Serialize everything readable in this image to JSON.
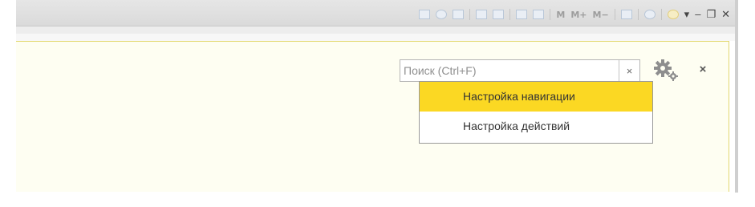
{
  "toolbar": {
    "memory_m": "M",
    "memory_m_plus": "M+",
    "memory_m_minus": "M−",
    "icons": [
      "save-icon",
      "print-icon",
      "preview-icon",
      "link-icon",
      "bookmark-icon",
      "calendar-icon",
      "calculator-icon",
      "memory-m-button",
      "memory-m-plus-button",
      "memory-m-minus-button",
      "panel-icon",
      "help-icon",
      "info-icon",
      "menu-chevron-icon",
      "minimize-icon",
      "restore-icon",
      "close-icon"
    ],
    "minimize_glyph": "–",
    "restore_glyph": "❐",
    "close_glyph": "✕",
    "chevron_glyph": "▾"
  },
  "search": {
    "placeholder": "Поиск (Ctrl+F)",
    "value": "",
    "clear_glyph": "×"
  },
  "panel": {
    "close_glyph": "×"
  },
  "menu": {
    "items": [
      {
        "label": "Настройка навигации",
        "highlighted": true
      },
      {
        "label": "Настройка действий",
        "highlighted": false
      }
    ]
  },
  "colors": {
    "highlight": "#fbd823",
    "panel_background": "#fefef2",
    "panel_border": "#e3d870"
  }
}
